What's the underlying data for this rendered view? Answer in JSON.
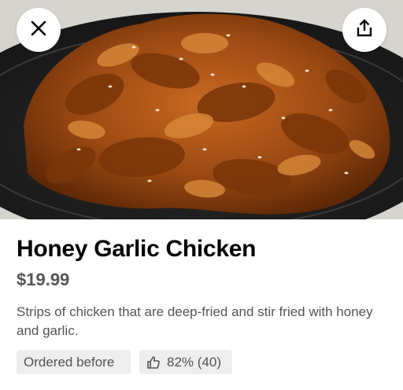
{
  "item": {
    "name": "Honey Garlic Chicken",
    "price": "$19.99",
    "description": "Strips of chicken that are deep-fried and stir fried with honey and garlic."
  },
  "badges": {
    "ordered_label": "Ordered before",
    "rating_label": "82% (40)"
  },
  "icons": {
    "close": "close-icon",
    "share": "share-icon",
    "rating": "thumbs-up-icon"
  },
  "colors": {
    "text_primary": "#000000",
    "text_secondary": "#545454",
    "chip_background": "#eeeeee"
  }
}
